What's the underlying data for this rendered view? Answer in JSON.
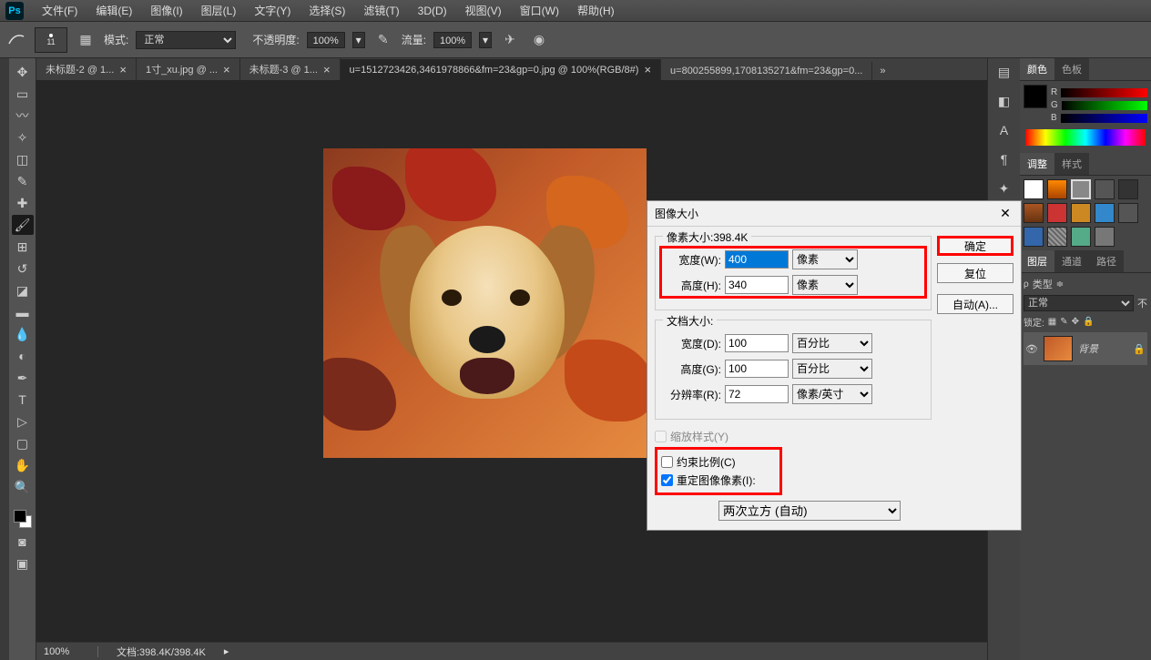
{
  "app": {
    "logo_text": "Ps"
  },
  "menu": {
    "items": [
      "文件(F)",
      "编辑(E)",
      "图像(I)",
      "图层(L)",
      "文字(Y)",
      "选择(S)",
      "滤镜(T)",
      "3D(D)",
      "视图(V)",
      "窗口(W)",
      "帮助(H)"
    ]
  },
  "options": {
    "brush_size": "11",
    "mode_label": "模式:",
    "mode_value": "正常",
    "opacity_label": "不透明度:",
    "opacity_value": "100%",
    "flow_label": "流量:",
    "flow_value": "100%"
  },
  "tabs": {
    "items": [
      {
        "label": "未标题-2 @ 1...",
        "active": false
      },
      {
        "label": "1寸_xu.jpg @ ...",
        "active": false
      },
      {
        "label": "未标题-3 @ 1...",
        "active": false
      },
      {
        "label": "u=1512723426,3461978866&fm=23&gp=0.jpg @ 100%(RGB/8#)",
        "active": true
      },
      {
        "label": "u=800255899,1708135271&fm=23&gp=0...",
        "active": false
      }
    ],
    "more": "»"
  },
  "status": {
    "zoom": "100%",
    "doc_label": "文档:398.4K/398.4K"
  },
  "panels": {
    "color_tab": "颜色",
    "swatch_tab": "色板",
    "adjust_tab": "调整",
    "styles_tab": "样式",
    "layers_tab": "图层",
    "channels_tab": "通道",
    "paths_tab": "路径",
    "r_label": "R",
    "g_label": "G",
    "b_label": "B",
    "kind_label": "类型",
    "blend_mode": "正常",
    "opacity_short": "不",
    "lock_label": "锁定:",
    "bg_layer_name": "背景"
  },
  "dialog": {
    "title": "图像大小",
    "pixel_dims_label": "像素大小:398.4K",
    "width_w_label": "宽度(W):",
    "width_w_value": "400",
    "height_h_label": "高度(H):",
    "height_h_value": "340",
    "unit_px": "像素",
    "doc_size_label": "文档大小:",
    "width_d_label": "宽度(D):",
    "width_d_value": "100",
    "height_g_label": "高度(G):",
    "height_g_value": "100",
    "unit_pct": "百分比",
    "res_label": "分辨率(R):",
    "res_value": "72",
    "unit_ppi": "像素/英寸",
    "scale_styles_label": "缩放样式(Y)",
    "constrain_label": "约束比例(C)",
    "resample_label": "重定图像像素(I):",
    "resample_method": "两次立方 (自动)",
    "ok_btn": "确定",
    "reset_btn": "复位",
    "auto_btn": "自动(A)..."
  }
}
